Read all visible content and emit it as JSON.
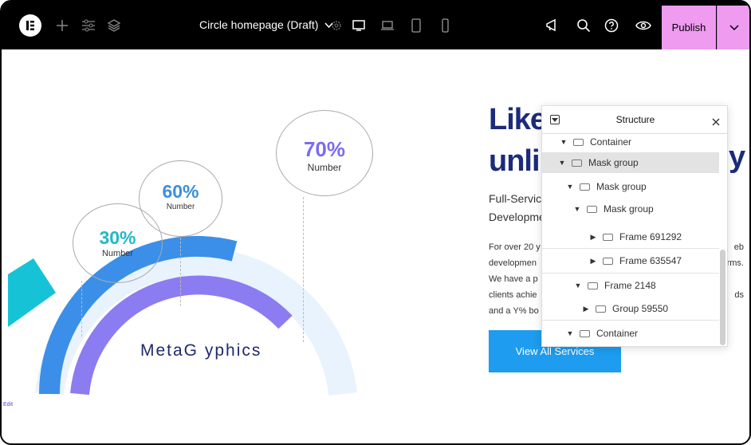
{
  "topbar": {
    "page_title": "Circle homepage (Draft)",
    "publish_label": "Publish"
  },
  "canvas": {
    "bubbles": [
      {
        "pct": "70%",
        "label": "Number",
        "color": "#7b6cf0"
      },
      {
        "pct": "60%",
        "label": "Number",
        "color": "#3a8fe0"
      },
      {
        "pct": "30%",
        "label": "Number",
        "color": "#22b8c8"
      }
    ],
    "brand": "MetaG yphics",
    "hero_title_line1": "Like",
    "hero_title_line2": "unli",
    "hero_title_tail": "y",
    "hero_sub_line1": "Full-Servic",
    "hero_sub_line2": "Developme",
    "hero_body": [
      {
        "left": "For over 20 y",
        "right": "eb"
      },
      {
        "left": "developmen",
        "right": "rms."
      },
      {
        "left": "We have a p",
        "right": ""
      },
      {
        "left": "clients achie",
        "right": "ds"
      },
      {
        "left": "and a Y% bo",
        "right": ""
      }
    ],
    "cta_label": "View All Services",
    "edit_label": "Edit"
  },
  "structure_panel": {
    "title": "Structure",
    "rows": [
      {
        "label": "Container",
        "caret": "▼"
      },
      {
        "label": "Mask group",
        "caret": "▼",
        "selected": true
      },
      {
        "label": "Mask group",
        "caret": "▼"
      },
      {
        "label": "Mask group",
        "caret": "▼"
      },
      {
        "label": "Frame 691292",
        "caret": "▶"
      },
      {
        "label": "Frame 635547",
        "caret": "▶"
      },
      {
        "label": "Frame 2148",
        "caret": "▼"
      },
      {
        "label": "Group 59550",
        "caret": "▶"
      },
      {
        "label": "Container",
        "caret": "▼"
      }
    ]
  },
  "colors": {
    "topbar_bg": "#000000",
    "publish_bg": "#ee9bf0",
    "cta_bg": "#1d9cf0",
    "title_color": "#1c2b7b",
    "arc_outer": "#3b8fe8",
    "arc_inner": "#8b7cf2",
    "arc_light": "#e9f3fd",
    "teal_shape": "#16c3d6"
  }
}
